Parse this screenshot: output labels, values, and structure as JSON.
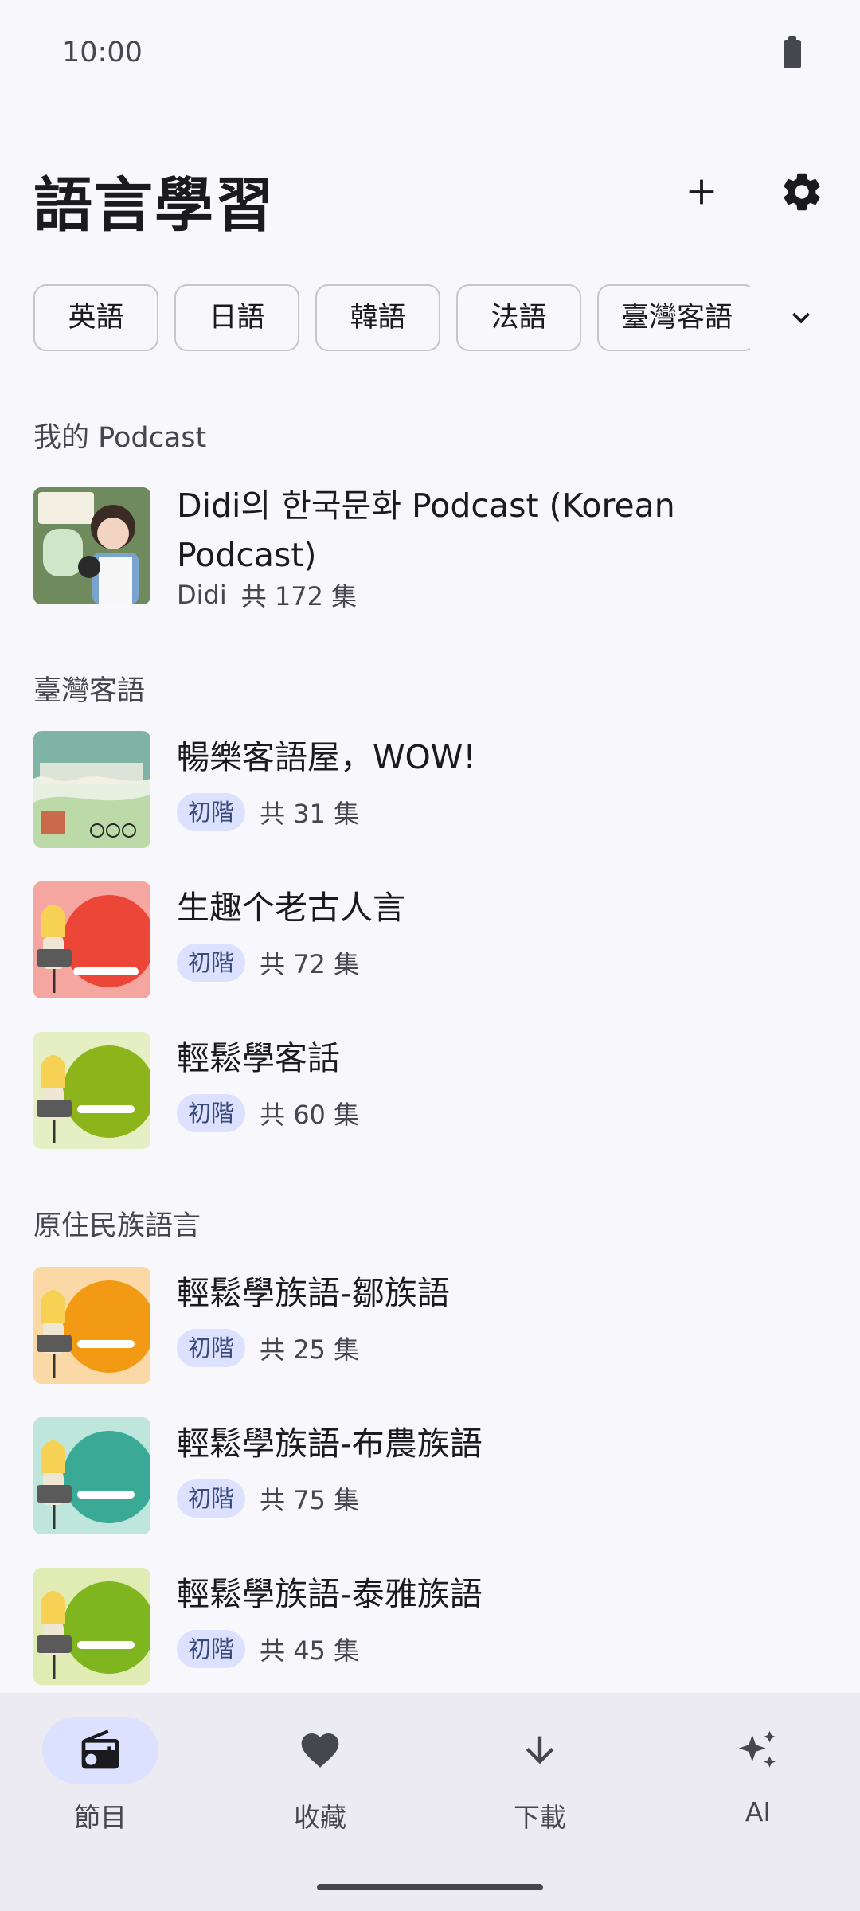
{
  "status_bar": {
    "time": "10:00"
  },
  "header": {
    "title": "語言學習"
  },
  "chips": [
    "英語",
    "日語",
    "韓語",
    "法語",
    "臺灣客語"
  ],
  "sections": [
    {
      "title": "我的 Podcast",
      "items": [
        {
          "title": "Didi의 한국문화 Podcast (Korean Podcast)",
          "author": "Didi",
          "count": "共 172 集"
        }
      ]
    },
    {
      "title": "臺灣客語",
      "items": [
        {
          "title": "暢樂客語屋，WOW!",
          "level": "初階",
          "count": "共 31 集"
        },
        {
          "title": "生趣个老古人言",
          "level": "初階",
          "count": "共 72 集"
        },
        {
          "title": "輕鬆學客話",
          "level": "初階",
          "count": "共 60 集"
        }
      ]
    },
    {
      "title": "原住民族語言",
      "items": [
        {
          "title": "輕鬆學族語-鄒族語",
          "level": "初階",
          "count": "共 25 集"
        },
        {
          "title": "輕鬆學族語-布農族語",
          "level": "初階",
          "count": "共 75 集"
        },
        {
          "title": "輕鬆學族語-泰雅族語",
          "level": "初階",
          "count": "共 45 集"
        }
      ]
    }
  ],
  "bottom_nav": [
    {
      "label": "節目",
      "icon": "radio-icon",
      "active": true
    },
    {
      "label": "收藏",
      "icon": "heart-icon"
    },
    {
      "label": "下載",
      "icon": "download-icon"
    },
    {
      "label": "AI",
      "icon": "sparkle-icon"
    }
  ],
  "colors": {
    "accent_bg": "#dbe1ff",
    "background": "#f8f7fc",
    "nav_bg": "#ecebf2"
  }
}
